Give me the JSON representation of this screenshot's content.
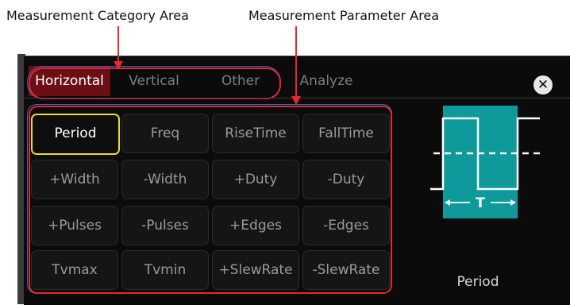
{
  "annotations": {
    "category_area": "Measurement Category Area",
    "parameter_area": "Measurement Parameter Area"
  },
  "tabs": [
    {
      "label": "Horizontal",
      "active": true
    },
    {
      "label": "Vertical",
      "active": false
    },
    {
      "label": "Other",
      "active": false
    },
    {
      "label": "Analyze",
      "active": false
    }
  ],
  "close_icon": "close-icon",
  "parameters": [
    [
      "Period",
      "Freq",
      "RiseTime",
      "FallTime"
    ],
    [
      "+Width",
      "-Width",
      "+Duty",
      "-Duty"
    ],
    [
      "+Pulses",
      "-Pulses",
      "+Edges",
      "-Edges"
    ],
    [
      "Tvmax",
      "Tvmin",
      "+SlewRate",
      "-SlewRate"
    ]
  ],
  "selected_parameter": "Period",
  "preview": {
    "period_marker": "T",
    "label": "Period"
  },
  "colors": {
    "annotation_red": "#e8262c",
    "annotation_blue": "#3b67c8",
    "active_tab": "#6b0f14",
    "selection_yellow": "#e6dc2a",
    "waveform_fill": "#0e9a9a"
  }
}
